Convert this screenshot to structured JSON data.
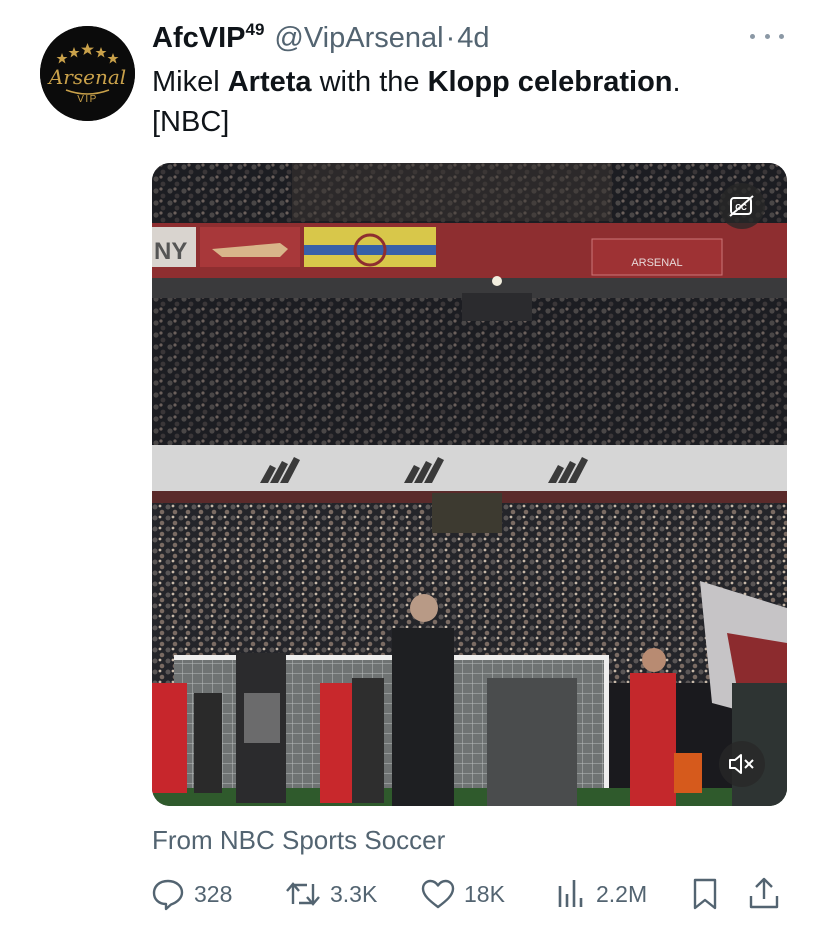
{
  "author": {
    "display_name": "AfcVIP",
    "superscript": "49",
    "handle": "@VipArsenal",
    "separator": "·",
    "time": "4d",
    "avatar_text": "Arsenal",
    "avatar_subtext": "VIP",
    "avatar_icon": "arsenal-vip-logo"
  },
  "tweet": {
    "text_1": "Mikel ",
    "text_2": "Arteta",
    "text_3": " with the ",
    "text_4": "Klopp celebration",
    "text_5": ".",
    "text_6": "[NBC]"
  },
  "media": {
    "banner_left": "NY",
    "banner_right": "ARSENAL",
    "cc_icon": "captions-off-icon",
    "mute_icon": "speaker-muted-icon"
  },
  "source": "From NBC Sports Soccer",
  "actions": {
    "reply_count": "328",
    "retweet_count": "3.3K",
    "like_count": "18K",
    "views_count": "2.2M"
  },
  "colors": {
    "text": "#0f1419",
    "muted": "#536471",
    "gold": "#c9a14a",
    "arsenal_red": "#b5252b"
  }
}
